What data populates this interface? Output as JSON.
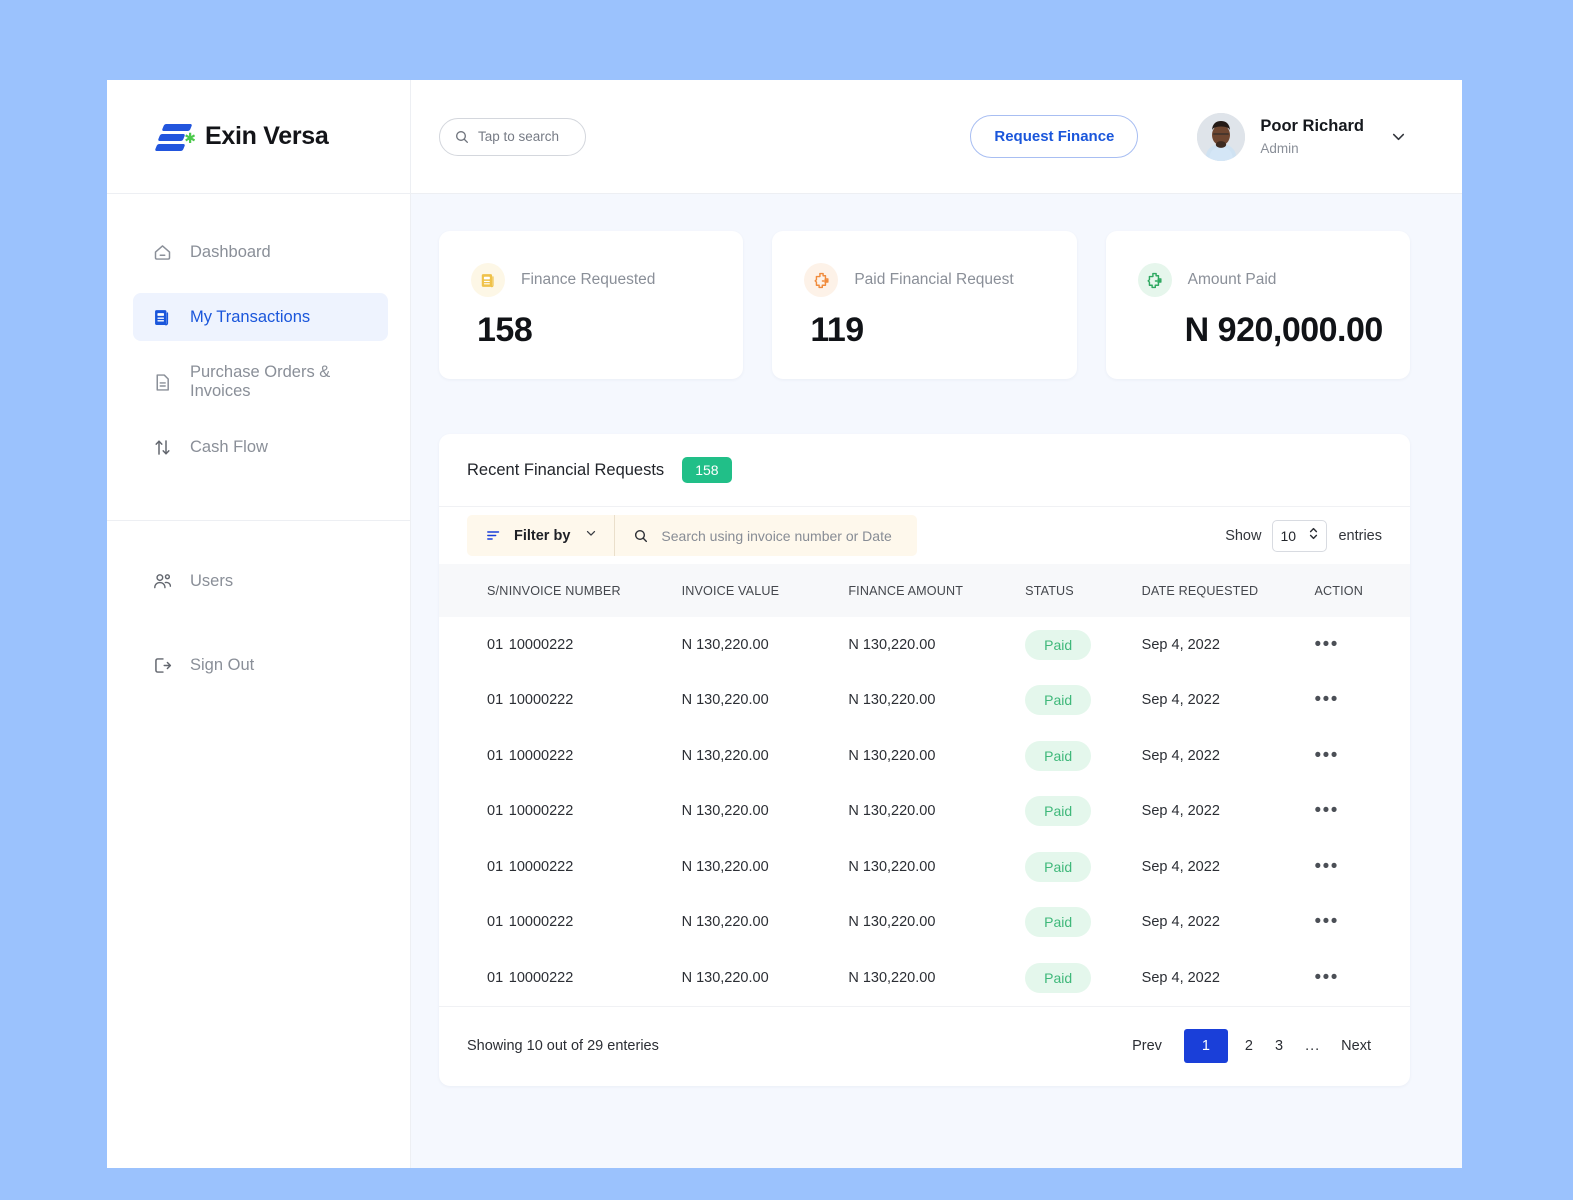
{
  "brand": {
    "name": "Exin Versa"
  },
  "topbar": {
    "search_placeholder": "Tap to search",
    "search_value": "",
    "request_finance_label": "Request Finance",
    "user_name": "Poor Richard",
    "user_role": "Admin"
  },
  "sidebar": {
    "items": [
      {
        "label": "Dashboard",
        "icon": "home-icon",
        "active": false
      },
      {
        "label": "My Transactions",
        "icon": "transactions-icon",
        "active": true
      },
      {
        "label": "Purchase Orders & Invoices",
        "icon": "document-icon",
        "active": false
      },
      {
        "label": "Cash Flow",
        "icon": "arrows-updown-icon",
        "active": false
      }
    ],
    "bottom_items": [
      {
        "label": "Users",
        "icon": "users-icon"
      },
      {
        "label": "Sign Out",
        "icon": "sign-out-icon"
      }
    ]
  },
  "stats": [
    {
      "label": "Finance Requested",
      "value": "158",
      "icon": "receipt-icon",
      "icon_color": "#EFC24A",
      "icon_bg": "#FDF7E6"
    },
    {
      "label": "Paid Financial Request",
      "value": "119",
      "icon": "puzzle-arrow-icon",
      "icon_color": "#F08B3C",
      "icon_bg": "#FDF2E8"
    },
    {
      "label": "Amount Paid",
      "value": "N 920,000.00",
      "icon": "puzzle-arrow-icon",
      "icon_color": "#2FA861",
      "icon_bg": "#E6F6EC"
    }
  ],
  "panel": {
    "title": "Recent Financial Requests",
    "count_badge": "158",
    "badge_color": "#21BF88",
    "filter_label": "Filter by",
    "invoice_search_placeholder": "Search using invoice number or Date",
    "invoice_search_value": "",
    "show_label": "Show",
    "entries_value": "10",
    "entries_label": "entries"
  },
  "table": {
    "columns": [
      "S/N",
      "INVOICE NUMBER",
      "INVOICE VALUE",
      "FINANCE AMOUNT",
      "STATUS",
      "DATE REQUESTED",
      "ACTION"
    ],
    "rows": [
      {
        "sn": "01",
        "invoice_number": "10000222",
        "invoice_value": "N 130,220.00",
        "finance_amount": "N 130,220.00",
        "status": "Paid",
        "date_requested": "Sep 4, 2022",
        "action": "•••"
      },
      {
        "sn": "01",
        "invoice_number": "10000222",
        "invoice_value": "N 130,220.00",
        "finance_amount": "N 130,220.00",
        "status": "Paid",
        "date_requested": "Sep 4, 2022",
        "action": "•••"
      },
      {
        "sn": "01",
        "invoice_number": "10000222",
        "invoice_value": "N 130,220.00",
        "finance_amount": "N 130,220.00",
        "status": "Paid",
        "date_requested": "Sep 4, 2022",
        "action": "•••"
      },
      {
        "sn": "01",
        "invoice_number": "10000222",
        "invoice_value": "N 130,220.00",
        "finance_amount": "N 130,220.00",
        "status": "Paid",
        "date_requested": "Sep 4, 2022",
        "action": "•••"
      },
      {
        "sn": "01",
        "invoice_number": "10000222",
        "invoice_value": "N 130,220.00",
        "finance_amount": "N 130,220.00",
        "status": "Paid",
        "date_requested": "Sep 4, 2022",
        "action": "•••"
      },
      {
        "sn": "01",
        "invoice_number": "10000222",
        "invoice_value": "N 130,220.00",
        "finance_amount": "N 130,220.00",
        "status": "Paid",
        "date_requested": "Sep 4, 2022",
        "action": "•••"
      },
      {
        "sn": "01",
        "invoice_number": "10000222",
        "invoice_value": "N 130,220.00",
        "finance_amount": "N 130,220.00",
        "status": "Paid",
        "date_requested": "Sep 4, 2022",
        "action": "•••"
      }
    ]
  },
  "footer": {
    "showing_text": "Showing 10 out of 29 enteries",
    "prev_label": "Prev",
    "pages": [
      "1",
      "2",
      "3"
    ],
    "ellipsis": "...",
    "next_label": "Next",
    "current_page": "1"
  },
  "colors": {
    "page_background": "#9BC2FD",
    "content_background": "#F5F8FE",
    "accent_blue": "#1A56DB",
    "pagination_active": "#1A3FD9",
    "status_green": "#3FB87A",
    "status_green_bg": "#E4F7EC",
    "filter_bar_bg": "#FEF8EC"
  }
}
